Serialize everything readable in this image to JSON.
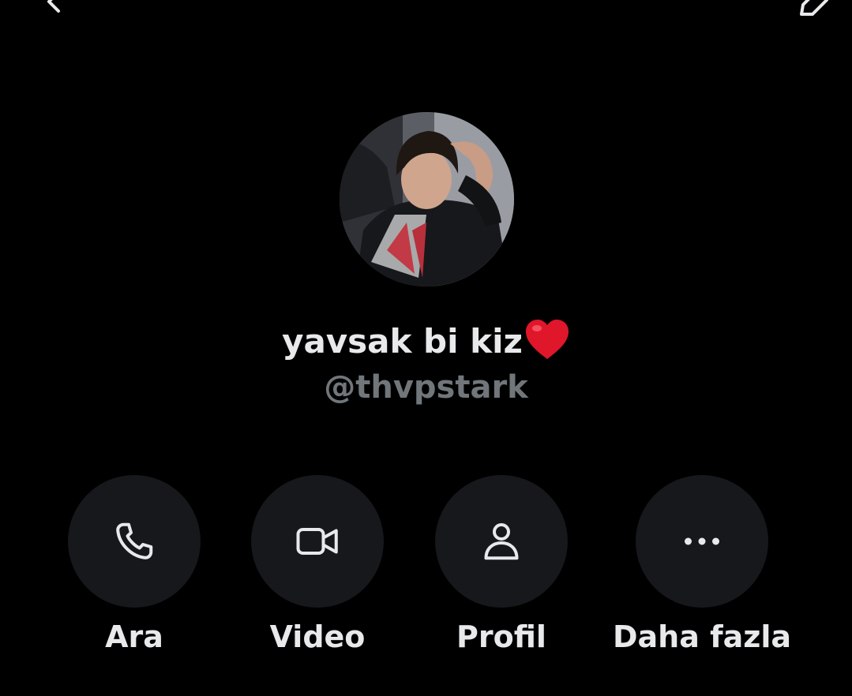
{
  "header": {
    "back_icon": "chevron-left-icon",
    "edit_icon": "edit-pencil-icon"
  },
  "profile": {
    "display_name": "yavsak bi kiz",
    "name_emoji": "heart-emoji",
    "handle": "@thvpstark"
  },
  "actions": [
    {
      "icon": "phone-icon",
      "label": "Ara"
    },
    {
      "icon": "video-camera-icon",
      "label": "Video"
    },
    {
      "icon": "person-icon",
      "label": "Profil"
    },
    {
      "icon": "more-dots-icon",
      "label": "Daha fazla"
    }
  ],
  "colors": {
    "background": "#000000",
    "primary_text": "#e7e9ea",
    "secondary_text": "#71767b",
    "action_circle": "#16181c",
    "heart": "#e0162b"
  }
}
